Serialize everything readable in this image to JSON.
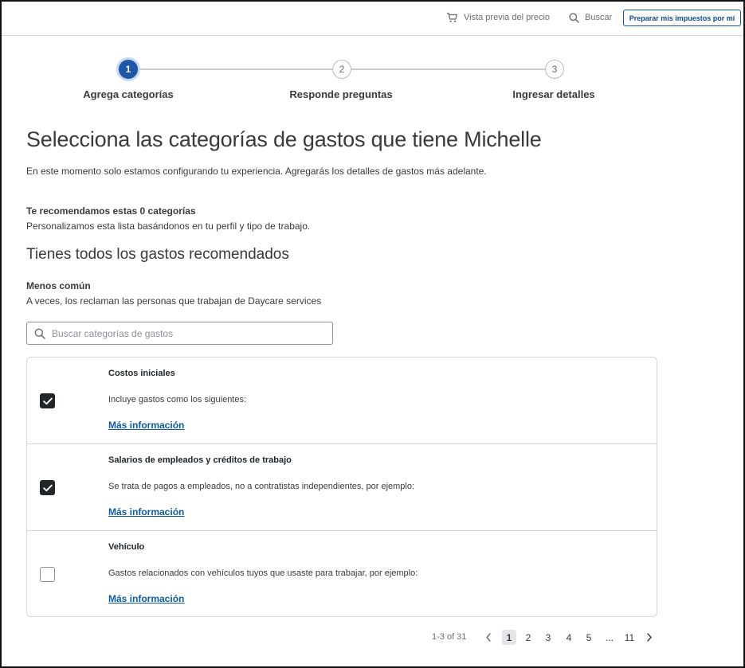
{
  "topbar": {
    "price_preview": "Vista previa del precio",
    "search": "Buscar",
    "prepare_button": "Preparar mis impuestos por mí"
  },
  "stepper": {
    "steps": [
      {
        "number": "1",
        "label": "Agrega categorías",
        "state": "active"
      },
      {
        "number": "2",
        "label": "Responde preguntas",
        "state": "pending"
      },
      {
        "number": "3",
        "label": "Ingresar detalles",
        "state": "pending"
      }
    ]
  },
  "main": {
    "title": "Selecciona las categorías de gastos que tiene Michelle",
    "intro": "En este momento solo estamos configurando tu experiencia. Agregarás los detalles de gastos más adelante.",
    "recommended_heading": "Te recomendamos estas 0 categorías",
    "recommended_sub": "Personalizamos esta lista basándonos en tu perfil y tipo de trabajo.",
    "all_recommended": "Tienes todos los gastos recomendados",
    "less_common_heading": "Menos común",
    "less_common_sub": "A veces, los reclaman las personas que trabajan de Daycare services"
  },
  "search": {
    "placeholder": "Buscar categorías de gastos",
    "value": ""
  },
  "categories": [
    {
      "title": "Costos iniciales",
      "description": "Incluye gastos como los siguientes:",
      "link": "Más información",
      "checked": true
    },
    {
      "title": "Salarios de empleados y créditos de trabajo",
      "description": "Se trata de pagos a empleados, no a contratistas independientes, por ejemplo:",
      "link": "Más información",
      "checked": true
    },
    {
      "title": "Vehículo",
      "description": "Gastos relacionados con vehículos tuyos que usaste para trabajar, por ejemplo:",
      "link": "Más información",
      "checked": false
    }
  ],
  "pagination": {
    "count": "1-3 of 31",
    "pages": [
      "1",
      "2",
      "3",
      "4",
      "5",
      "...",
      "11"
    ],
    "current": "1"
  },
  "colors": {
    "accent": "#1d57a6",
    "link": "#0d5aa7",
    "checkbox_checked": "#21262b",
    "border": "#d4d7dc"
  }
}
